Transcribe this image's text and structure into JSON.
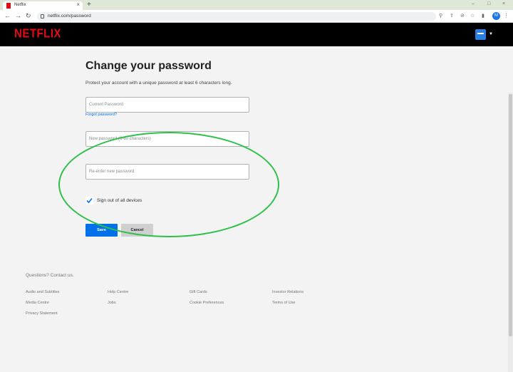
{
  "browser": {
    "tab_title": "Netflix",
    "tab_close": "×",
    "new_tab": "+",
    "url": "netflix.com/password",
    "profile_letter": "M",
    "win_min": "–",
    "win_max": "□",
    "win_close": "×"
  },
  "header": {
    "logo": "NETFLIX"
  },
  "form": {
    "title": "Change your password",
    "subtitle": "Protect your account with a unique password at least 6 characters long.",
    "current_password_placeholder": "Current Password",
    "forgot_link": "Forgot password?",
    "new_password_placeholder": "New password (6-60 characters)",
    "reenter_placeholder": "Re-enter new password",
    "signout_label": "Sign out of all devices",
    "signout_checked": true,
    "save_label": "Save",
    "cancel_label": "Cancel"
  },
  "footer": {
    "contact": "Questions? Contact us.",
    "links": [
      "Audio and Subtitles",
      "Help Centre",
      "Gift Cards",
      "Investor Relations",
      "Media Centre",
      "Jobs",
      "Cookie Preferences",
      "Terms of Use",
      "Privacy Statement"
    ]
  },
  "colors": {
    "brand_red": "#e50914",
    "primary_blue": "#0071eb",
    "highlight_green": "#2ec04a"
  }
}
